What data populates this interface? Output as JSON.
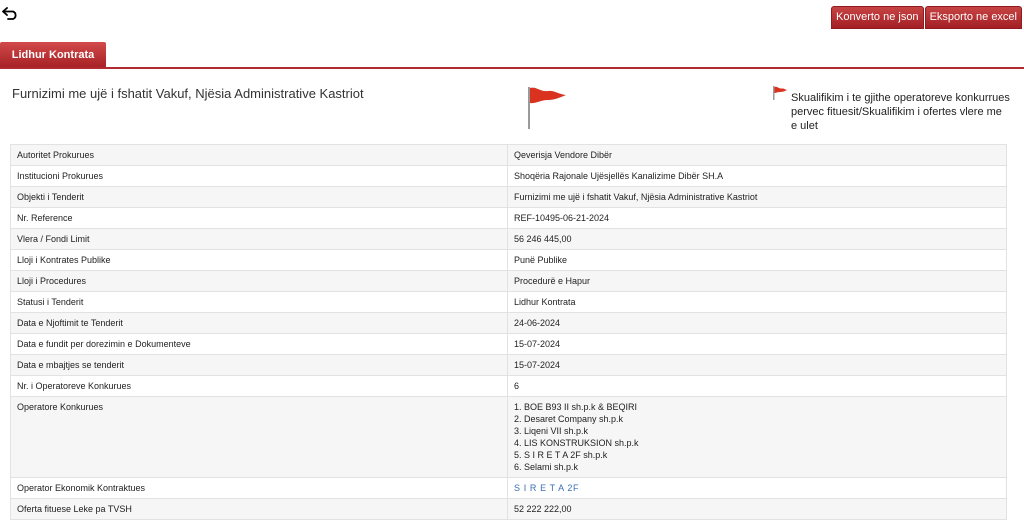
{
  "toolbar": {
    "back_icon": "back-arrow-icon",
    "convert_json_label": "Konverto ne json",
    "export_excel_label": "Eksporto ne excel"
  },
  "tabs": [
    {
      "label": "Lidhur Kontrata"
    }
  ],
  "tender": {
    "title": "Furnizimi me ujë i fshatit Vakuf, Njësia Administrative Kastriot",
    "status_text": "Skualifikim i te gjithe operatoreve konkurrues pervec fituesit/Skualifikim i ofertes vlere me e ulet",
    "flag_color": "#d9321f"
  },
  "details": {
    "rows": [
      {
        "label": "Autoritet Prokurues",
        "value": "Qeverisja Vendore Dibër"
      },
      {
        "label": "Institucioni Prokurues",
        "value": "Shoqëria Rajonale Ujësjellës Kanalizime Dibër SH.A"
      },
      {
        "label": "Objekti i Tenderit",
        "value": "Furnizimi me ujë i fshatit Vakuf, Njësia Administrative Kastriot"
      },
      {
        "label": "Nr. Reference",
        "value": "REF-10495-06-21-2024"
      },
      {
        "label": "Vlera / Fondi Limit",
        "value": "56 246 445,00"
      },
      {
        "label": "Lloji i Kontrates Publike",
        "value": "Punë Publike"
      },
      {
        "label": "Lloji i Procedures",
        "value": "Procedurë e Hapur"
      },
      {
        "label": "Statusi i Tenderit",
        "value": "Lidhur Kontrata"
      },
      {
        "label": "Data e Njoftimit te Tenderit",
        "value": "24-06-2024"
      },
      {
        "label": "Data e fundit per dorezimin e Dokumenteve",
        "value": "15-07-2024"
      },
      {
        "label": "Data e mbajtjes se tenderit",
        "value": "15-07-2024"
      },
      {
        "label": "Nr. i Operatoreve Konkurues",
        "value": "6"
      }
    ],
    "operators_label": "Operatore Konkurues",
    "operators": [
      "1. BOE B93 II sh.p.k & BEQIRI",
      "2. Desaret Company sh.p.k",
      "3. Liqeni VII sh.p.k",
      "4. LIS KONSTRUKSION sh.p.k",
      "5. S I R E T A 2F sh.p.k",
      "6. Selami sh.p.k"
    ],
    "winner_label": "Operator Ekonomik Kontraktues",
    "winner_value": "S I R E T A 2F",
    "offer_label": "Oferta fituese Leke pa TVSH",
    "offer_value": "52 222 222,00"
  }
}
